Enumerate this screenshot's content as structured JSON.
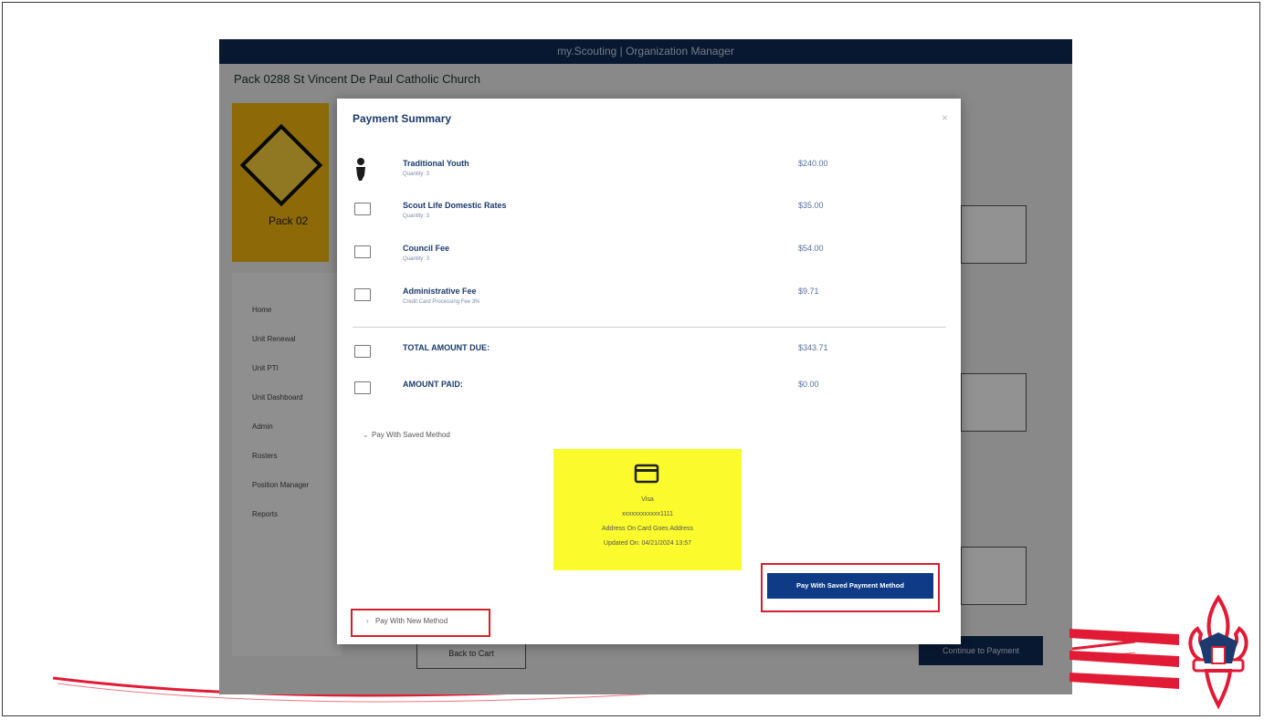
{
  "app": {
    "topbar_title": "my.Scouting | Organization Manager",
    "unit_title": "Pack 0288 St Vincent De Paul Catholic Church",
    "unit_name": "Pack 02",
    "nav_items": [
      "Home",
      "Unit Renewal",
      "Unit PTI",
      "Unit Dashboard",
      "Admin",
      "Rosters",
      "Position Manager",
      "Reports"
    ],
    "back_button": "Back to Cart",
    "continue_button": "Continue to Payment"
  },
  "modal": {
    "title": "Payment Summary",
    "close": "×",
    "items": [
      {
        "name": "Traditional Youth",
        "sub": "Quantity: 3",
        "amount": "$240.00",
        "icon": "person-icon"
      },
      {
        "name": "Scout Life Domestic Rates",
        "sub": "Quantity: 3",
        "amount": "$35.00",
        "icon": "card-icon"
      },
      {
        "name": "Council Fee",
        "sub": "Quantity: 3",
        "amount": "$54.00",
        "icon": "card-icon"
      },
      {
        "name": "Administrative Fee",
        "sub": "Credit Card Processing Fee 3%",
        "amount": "$9.71",
        "icon": "card-icon"
      }
    ],
    "totals": [
      {
        "name": "TOTAL AMOUNT DUE:",
        "amount": "$343.71"
      },
      {
        "name": "AMOUNT PAID:",
        "amount": "$0.00"
      }
    ],
    "pay_saved_toggle": "Pay With Saved Method",
    "saved_card": {
      "brand": "Visa",
      "number": "xxxxxxxxxxxx1111",
      "address": "Address On Card Goes Address",
      "updated": "Updated On: 04/21/2024 13:57"
    },
    "pay_saved_button": "Pay With Saved Payment Method",
    "pay_new_toggle": "Pay With New Method"
  },
  "colors": {
    "navy": "#0e2a55",
    "modal_title": "#1c3a6e",
    "highlight_red": "#d61f2e",
    "saved_card_yellow": "#fafa2c",
    "pay_button": "#0e3a86",
    "bsa_red": "#e11b35"
  }
}
